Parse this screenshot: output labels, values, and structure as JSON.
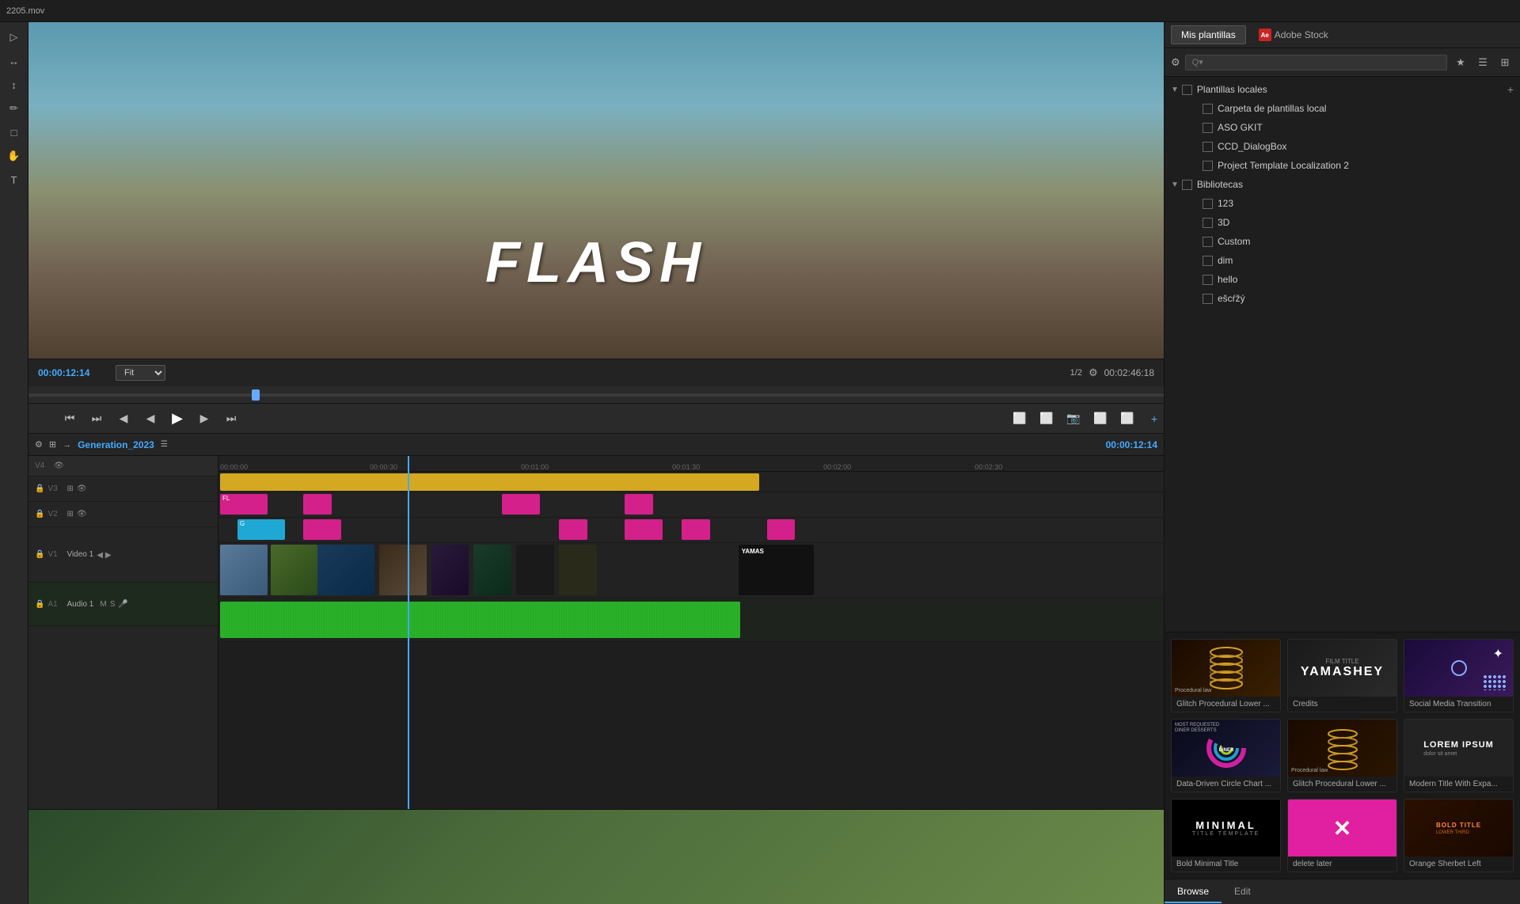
{
  "topbar": {
    "filename": "2205.mov"
  },
  "lefttools": {
    "icons": [
      "▷",
      "↔",
      "↕",
      "✏",
      "□",
      "✋",
      "T"
    ]
  },
  "videoPreview": {
    "timecode": "00:00:12:14",
    "fitLabel": "Fit",
    "frameCounter": "1/2",
    "endTimecode": "00:02:46:18",
    "flashText": "FLASH"
  },
  "transport": {
    "buttons": [
      "⏮",
      "⏭",
      "◀|",
      "|▶",
      "⏮⏮",
      "◀◀",
      "▶",
      "▶▶",
      "⏭⏭"
    ]
  },
  "timeline": {
    "sequenceName": "Generation_2023",
    "timecode": "00:00:12:14",
    "rulerMarks": [
      "00:00:00",
      "00:00:30",
      "00:01:00",
      "00:01:30",
      "00:02:00",
      "00:02:30"
    ],
    "tracks": [
      {
        "id": "V4",
        "label": "V4"
      },
      {
        "id": "V3",
        "label": "V3"
      },
      {
        "id": "V2",
        "label": "V2"
      },
      {
        "id": "V1",
        "label": "Video 1"
      },
      {
        "id": "A1",
        "label": "Audio 1"
      }
    ]
  },
  "rightPanel": {
    "tabs": [
      "Mis plantillas",
      "Adobe Stock"
    ],
    "searchPlaceholder": "Q▾",
    "tree": {
      "sections": [
        {
          "id": "plantillasLocales",
          "label": "Plantillas locales",
          "expanded": true,
          "children": [
            {
              "id": "carpeta",
              "label": "Carpeta de plantillas local"
            },
            {
              "id": "asoGkit",
              "label": "ASO GKIT"
            },
            {
              "id": "ccdDialog",
              "label": "CCD_DialogBox"
            },
            {
              "id": "projectTemplate",
              "label": "Project Template Localization 2"
            }
          ]
        },
        {
          "id": "bibliotecas",
          "label": "Bibliotecas",
          "expanded": true,
          "children": [
            {
              "id": "b123",
              "label": "123"
            },
            {
              "id": "b3d",
              "label": "3D"
            },
            {
              "id": "bCustom",
              "label": "Custom"
            },
            {
              "id": "bDim",
              "label": "dim"
            },
            {
              "id": "bHello",
              "label": "hello"
            },
            {
              "id": "bEscrzy",
              "label": "ešcŕžý"
            }
          ]
        }
      ]
    },
    "templates": [
      {
        "id": "t1",
        "name": "Glitch Procedural Lower ...",
        "thumbType": "dna"
      },
      {
        "id": "t2",
        "name": "Credits",
        "thumbType": "credits"
      },
      {
        "id": "t3",
        "name": "Social Media Transition",
        "thumbType": "social"
      },
      {
        "id": "t4",
        "name": "Data-Driven Circle Chart ...",
        "thumbType": "circle"
      },
      {
        "id": "t5",
        "name": "Glitch Procedural Lower ...",
        "thumbType": "dna2"
      },
      {
        "id": "t6",
        "name": "Modern Title With Expa...",
        "thumbType": "lorem"
      },
      {
        "id": "t7",
        "name": "Bold Minimal Title",
        "thumbType": "minimal"
      },
      {
        "id": "t8",
        "name": "delete later",
        "thumbType": "delete"
      },
      {
        "id": "t9",
        "name": "Orange Sherbet Left",
        "thumbType": "orange"
      }
    ],
    "bottomTabs": [
      "Browse",
      "Edit"
    ]
  },
  "bottomPreview": {
    "visible": true
  }
}
